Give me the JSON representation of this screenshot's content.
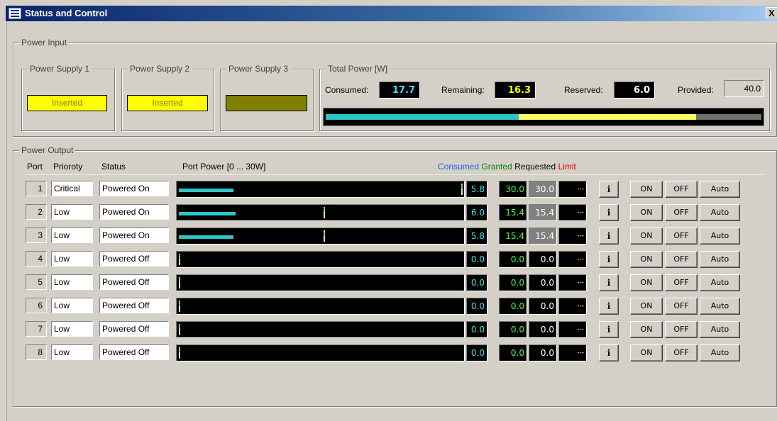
{
  "window": {
    "title": "Status and Control",
    "close_label": "X"
  },
  "power_input": {
    "title": "Power Input",
    "supplies": [
      {
        "title": "Power Supply 1",
        "status": "Inserted",
        "color": "#ffff00"
      },
      {
        "title": "Power Supply 2",
        "status": "Inserted",
        "color": "#ffff00"
      },
      {
        "title": "Power Supply 3",
        "status": "",
        "color": "#808000"
      }
    ],
    "total": {
      "title": "Total Power [W]",
      "consumed_label": "Consumed:",
      "consumed": "17.7",
      "consumed_color": "#40e0f0",
      "remaining_label": "Remaining:",
      "remaining": "16.3",
      "remaining_color": "#ffff00",
      "reserved_label": "Reserved:",
      "reserved": "6.0",
      "provided_label": "Provided:",
      "provided": "40.0",
      "bar": {
        "consumed_fraction": 0.4425,
        "remaining_fraction": 0.4075,
        "reserved_fraction": 0.15,
        "consumed_color": "#2ec5c5",
        "remaining_color": "#ffff66",
        "reserved_color": "#707070"
      }
    }
  },
  "power_output": {
    "title": "Power Output",
    "headers": {
      "port": "Port",
      "priority": "Prioroty",
      "status": "Status",
      "port_power": "Port Power [0 ... 30W]"
    },
    "legend": [
      {
        "text": "Consumed",
        "color": "#2060e0"
      },
      {
        "text": "Granted",
        "color": "#008000"
      },
      {
        "text": "Requested",
        "color": "#000000"
      },
      {
        "text": "Limit",
        "color": "#e00000"
      }
    ],
    "buttons": {
      "info": "i",
      "on": "ON",
      "off": "OFF",
      "auto": "Auto"
    },
    "max_power": 30,
    "ports": [
      {
        "port": "1",
        "priority": "Critical",
        "status": "Powered On",
        "consumed": "5.8",
        "granted": "30.0",
        "requested": "30.0",
        "limit": "---"
      },
      {
        "port": "2",
        "priority": "Low",
        "status": "Powered On",
        "consumed": "6.0",
        "granted": "15.4",
        "requested": "15.4",
        "limit": "---"
      },
      {
        "port": "3",
        "priority": "Low",
        "status": "Powered On",
        "consumed": "5.8",
        "granted": "15.4",
        "requested": "15.4",
        "limit": "---"
      },
      {
        "port": "4",
        "priority": "Low",
        "status": "Powered Off",
        "consumed": "0.0",
        "granted": "0.0",
        "requested": "0.0",
        "limit": "---"
      },
      {
        "port": "5",
        "priority": "Low",
        "status": "Powered Off",
        "consumed": "0.0",
        "granted": "0.0",
        "requested": "0.0",
        "limit": "---"
      },
      {
        "port": "6",
        "priority": "Low",
        "status": "Powered Off",
        "consumed": "0.0",
        "granted": "0.0",
        "requested": "0.0",
        "limit": "---"
      },
      {
        "port": "7",
        "priority": "Low",
        "status": "Powered Off",
        "consumed": "0.0",
        "granted": "0.0",
        "requested": "0.0",
        "limit": "---"
      },
      {
        "port": "8",
        "priority": "Low",
        "status": "Powered Off",
        "consumed": "0.0",
        "granted": "0.0",
        "requested": "0.0",
        "limit": "---"
      }
    ]
  }
}
